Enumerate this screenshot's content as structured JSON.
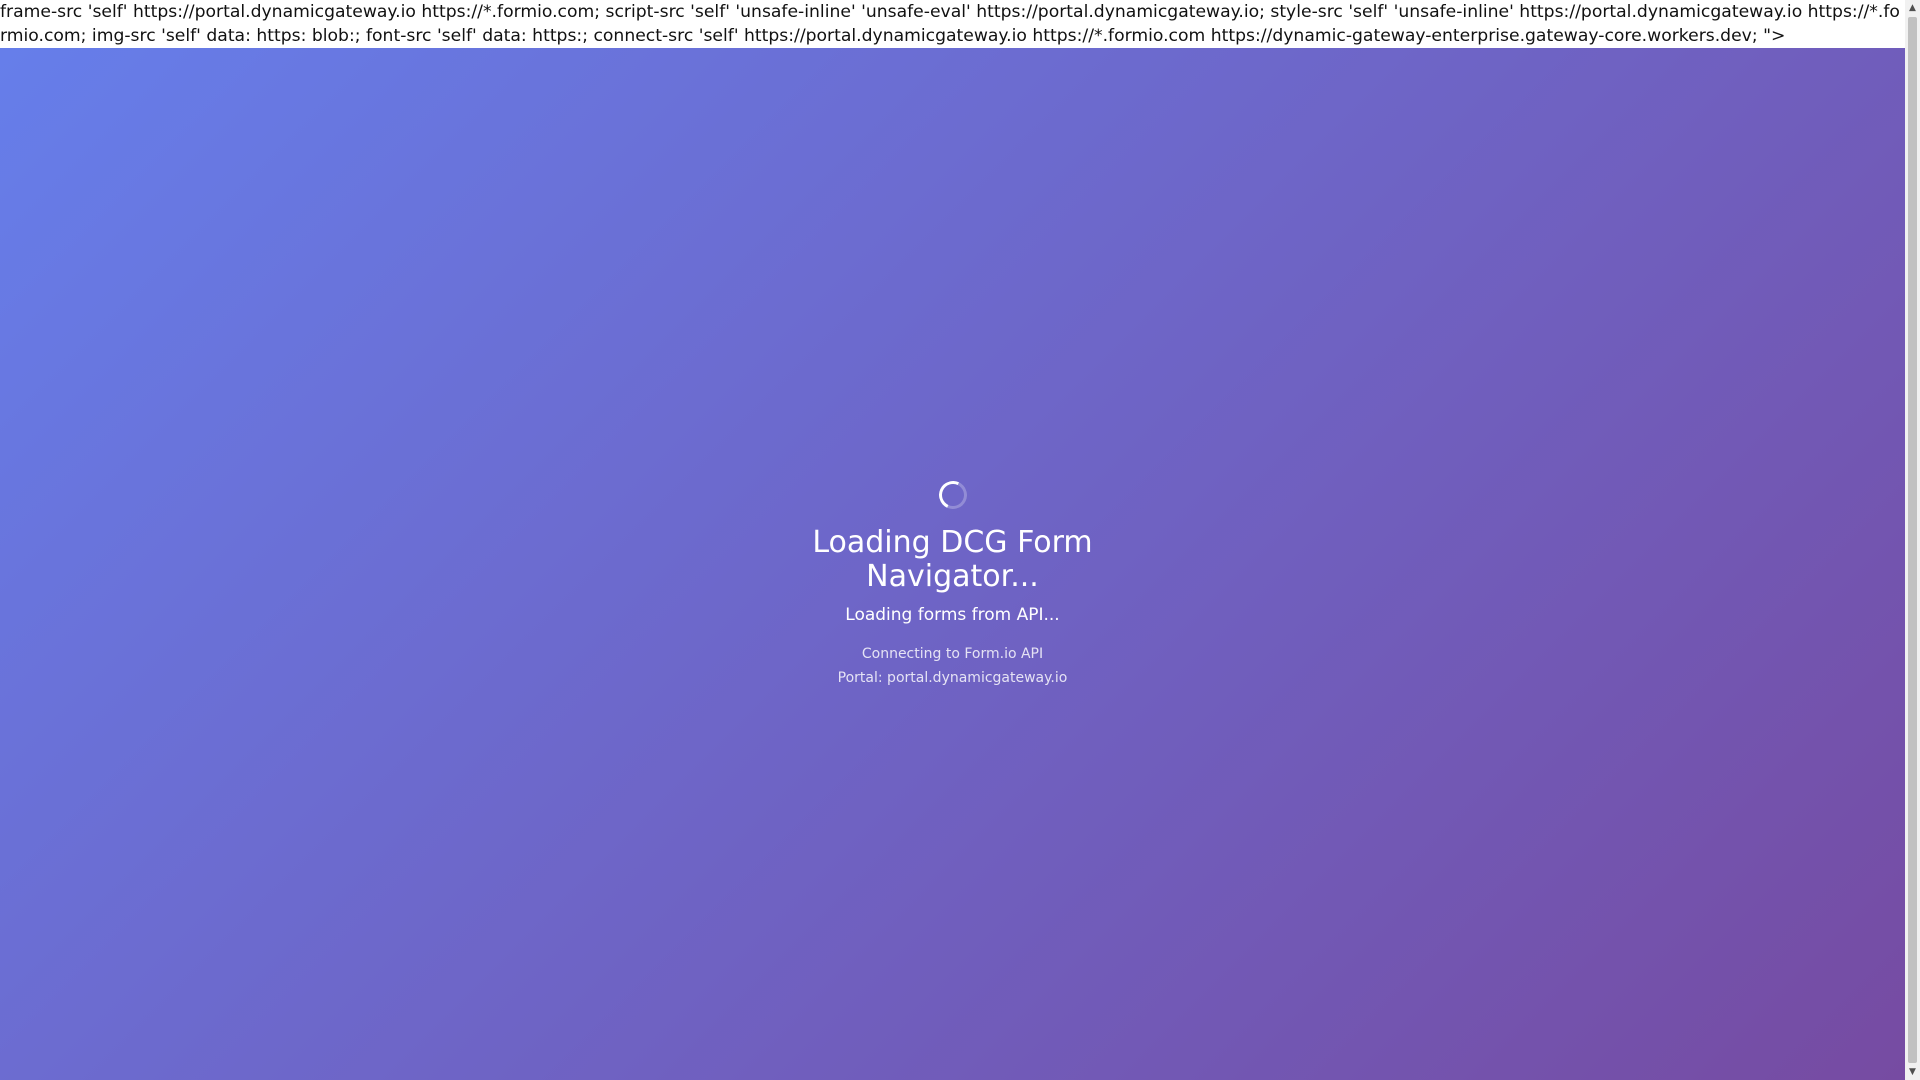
{
  "csp_text": "frame-src 'self' https://portal.dynamicgateway.io https://*.formio.com; script-src 'self' 'unsafe-inline' 'unsafe-eval' https://portal.dynamicgateway.io; style-src 'self' 'unsafe-inline' https://portal.dynamicgateway.io https://*.formio.com; img-src 'self' data: https: blob:; font-src 'self' data: https:; connect-src 'self' https://portal.dynamicgateway.io https://*.formio.com https://dynamic-gateway-enterprise.gateway-core.workers.dev; \">",
  "loader": {
    "spinner_icon": "loading-spinner-icon",
    "title": "Loading DCG Form Navigator...",
    "subtitle": "Loading forms from API...",
    "status": "Connecting to Form.io API",
    "portal": "Portal: portal.dynamicgateway.io"
  },
  "colors": {
    "gradient_start": "#667eea",
    "gradient_end": "#764ba2",
    "text": "#ffffff"
  },
  "scrollbar": {
    "up_icon": "scroll-up-arrow-icon",
    "down_icon": "scroll-down-arrow-icon"
  }
}
